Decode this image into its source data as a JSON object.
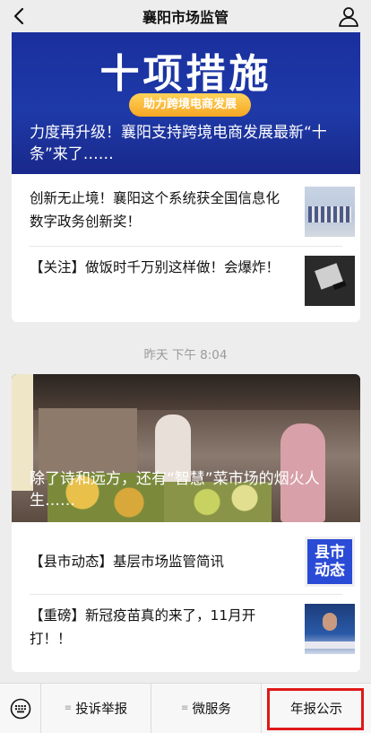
{
  "header": {
    "title": "襄阳市场监管"
  },
  "card1": {
    "hero": {
      "big_text": "十项措施",
      "pill": "助力跨境电商发展",
      "caption": "力度再升级！襄阳支持跨境电商发展最新“十条”来了……"
    },
    "items": [
      {
        "text": "创新无止境！襄阳这个系统获全国信息化数字政务创新奖！",
        "thumb": "award-ceremony-photo"
      },
      {
        "text": "【关注】做饭时千万别这样做！会爆炸！",
        "thumb": "cleaver-knife-photo"
      }
    ]
  },
  "timestamp": "昨天 下午 8:04",
  "card2": {
    "hero": {
      "caption": "除了诗和远方，还有“智慧”菜市场的烟火人生……"
    },
    "items": [
      {
        "text": "【县市动态】基层市场监管简讯",
        "thumb_lines": [
          "县市",
          "动态"
        ]
      },
      {
        "text": "【重磅】新冠疫苗真的来了，11月开打！！",
        "thumb": "news-broadcast-photo"
      }
    ]
  },
  "menu": {
    "items": [
      {
        "label": "投诉举报",
        "has_submenu": true
      },
      {
        "label": "微服务",
        "has_submenu": true
      },
      {
        "label": "年报公示",
        "has_submenu": false
      }
    ],
    "highlight_color": "#e01818"
  }
}
